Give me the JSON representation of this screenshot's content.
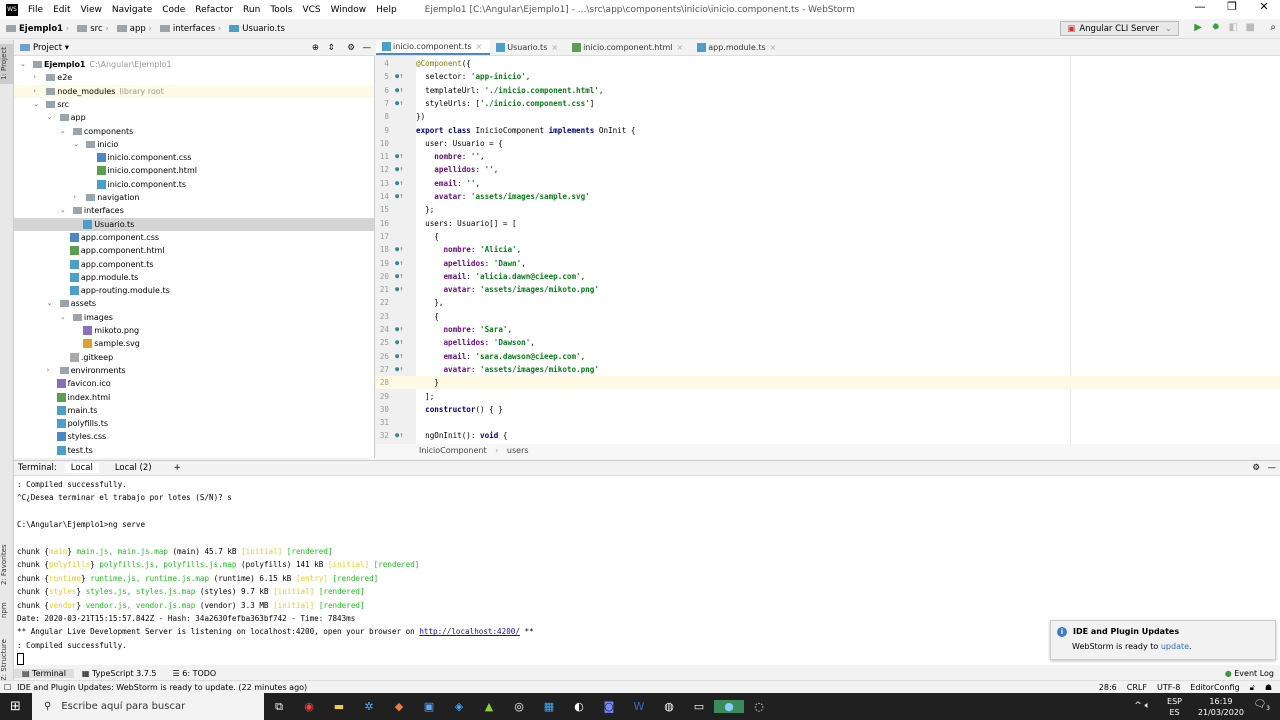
{
  "window": {
    "title": "Ejemplo1 [C:\\Angular\\Ejemplo1] - ...\\src\\app\\components\\inicio\\inicio.component.ts - WebStorm",
    "logo": "WS",
    "minimize": "—",
    "maximize": "❐",
    "close": "✕"
  },
  "menu": [
    "File",
    "Edit",
    "View",
    "Navigate",
    "Code",
    "Refactor",
    "Run",
    "Tools",
    "VCS",
    "Window",
    "Help"
  ],
  "breadcrumb": [
    "Ejemplo1",
    "src",
    "app",
    "interfaces",
    "Usuario.ts"
  ],
  "run_config": "Angular CLI Server",
  "left_strip": {
    "project": "1: Project",
    "favorites": "2: Favorites",
    "npm": "npm",
    "structure": "Z: Structure"
  },
  "project_panel": {
    "title": "Project ▾",
    "tree": [
      {
        "level": 0,
        "type": "folder",
        "open": true,
        "name": "Ejemplo1",
        "hint": "C:\\Angular\\Ejemplo1"
      },
      {
        "level": 1,
        "type": "folder",
        "open": false,
        "name": "e2e"
      },
      {
        "level": 1,
        "type": "folder",
        "open": false,
        "name": "node_modules",
        "hint": "library root",
        "lib": true
      },
      {
        "level": 1,
        "type": "folder",
        "open": true,
        "name": "src"
      },
      {
        "level": 2,
        "type": "folder",
        "open": true,
        "name": "app"
      },
      {
        "level": 3,
        "type": "folder",
        "open": true,
        "name": "components"
      },
      {
        "level": 4,
        "type": "folder",
        "open": true,
        "name": "inicio"
      },
      {
        "level": 5,
        "type": "css",
        "name": "inicio.component.css"
      },
      {
        "level": 5,
        "type": "html",
        "name": "inicio.component.html"
      },
      {
        "level": 5,
        "type": "ts",
        "name": "inicio.component.ts"
      },
      {
        "level": 4,
        "type": "folder",
        "open": false,
        "name": "navigation"
      },
      {
        "level": 3,
        "type": "folder",
        "open": true,
        "name": "interfaces"
      },
      {
        "level": 4,
        "type": "ts",
        "name": "Usuario.ts",
        "selected": true
      },
      {
        "level": 3,
        "type": "css",
        "name": "app.component.css"
      },
      {
        "level": 3,
        "type": "html",
        "name": "app.component.html"
      },
      {
        "level": 3,
        "type": "ts",
        "name": "app.component.ts"
      },
      {
        "level": 3,
        "type": "ts",
        "name": "app.module.ts"
      },
      {
        "level": 3,
        "type": "ts",
        "name": "app-routing.module.ts"
      },
      {
        "level": 2,
        "type": "folder",
        "open": true,
        "name": "assets"
      },
      {
        "level": 3,
        "type": "folder",
        "open": true,
        "name": "images"
      },
      {
        "level": 4,
        "type": "png",
        "name": "mikoto.png"
      },
      {
        "level": 4,
        "type": "svg",
        "name": "sample.svg"
      },
      {
        "level": 3,
        "type": "file",
        "name": ".gitkeep"
      },
      {
        "level": 2,
        "type": "folder",
        "open": false,
        "name": "environments"
      },
      {
        "level": 2,
        "type": "ico",
        "name": "favicon.ico"
      },
      {
        "level": 2,
        "type": "html",
        "name": "index.html"
      },
      {
        "level": 2,
        "type": "ts",
        "name": "main.ts"
      },
      {
        "level": 2,
        "type": "ts",
        "name": "polyfills.ts"
      },
      {
        "level": 2,
        "type": "css",
        "name": "styles.css"
      },
      {
        "level": 2,
        "type": "ts",
        "name": "test.ts"
      }
    ]
  },
  "editor_tabs": [
    {
      "label": "inicio.component.ts",
      "active": true
    },
    {
      "label": "Usuario.ts"
    },
    {
      "label": "inicio.component.html"
    },
    {
      "label": "app.module.ts"
    }
  ],
  "code": [
    {
      "n": "4",
      "t": [
        [
          "@Component",
          "an"
        ],
        [
          "({",
          ""
        ]
      ]
    },
    {
      "n": "5",
      "m": true,
      "t": [
        [
          "  selector: ",
          ""
        ],
        [
          "'app-inicio'",
          "st"
        ],
        [
          ",",
          ""
        ]
      ]
    },
    {
      "n": "6",
      "m": true,
      "t": [
        [
          "  templateUrl: ",
          ""
        ],
        [
          "'./inicio.component.html'",
          "st"
        ],
        [
          ",",
          ""
        ]
      ]
    },
    {
      "n": "7",
      "m": true,
      "t": [
        [
          "  styleUrls: [",
          ""
        ],
        [
          "'./inicio.component.css'",
          "st"
        ],
        [
          "]",
          ""
        ]
      ]
    },
    {
      "n": "8",
      "t": [
        [
          "})",
          ""
        ]
      ]
    },
    {
      "n": "9",
      "t": [
        [
          "export class ",
          "kw"
        ],
        [
          "InicioComponent ",
          ""
        ],
        [
          "implements ",
          "kw"
        ],
        [
          "OnInit {",
          ""
        ]
      ]
    },
    {
      "n": "10",
      "t": [
        [
          "  user: Usuario = {",
          ""
        ]
      ]
    },
    {
      "n": "11",
      "m": true,
      "t": [
        [
          "    ",
          ""
        ],
        [
          "nombre",
          "pr"
        ],
        [
          ": ",
          ""
        ],
        [
          "''",
          "st"
        ],
        [
          ",",
          ""
        ]
      ]
    },
    {
      "n": "12",
      "m": true,
      "t": [
        [
          "    ",
          ""
        ],
        [
          "apellidos",
          "pr"
        ],
        [
          ": ",
          ""
        ],
        [
          "''",
          "st"
        ],
        [
          ",",
          ""
        ]
      ]
    },
    {
      "n": "13",
      "m": true,
      "t": [
        [
          "    ",
          ""
        ],
        [
          "email",
          "pr"
        ],
        [
          ": ",
          ""
        ],
        [
          "''",
          "st"
        ],
        [
          ",",
          ""
        ]
      ]
    },
    {
      "n": "14",
      "m": true,
      "t": [
        [
          "    ",
          ""
        ],
        [
          "avatar",
          "pr"
        ],
        [
          ": ",
          ""
        ],
        [
          "'assets/images/sample.svg'",
          "st"
        ]
      ]
    },
    {
      "n": "15",
      "t": [
        [
          "  };",
          ""
        ]
      ]
    },
    {
      "n": "16",
      "t": [
        [
          "  users: Usuario[] = [",
          ""
        ]
      ]
    },
    {
      "n": "17",
      "t": [
        [
          "    {",
          ""
        ]
      ]
    },
    {
      "n": "18",
      "m": true,
      "t": [
        [
          "      ",
          ""
        ],
        [
          "nombre",
          "pr"
        ],
        [
          ": ",
          ""
        ],
        [
          "'Alicia'",
          "st"
        ],
        [
          ",",
          ""
        ]
      ]
    },
    {
      "n": "19",
      "m": true,
      "t": [
        [
          "      ",
          ""
        ],
        [
          "apellidos",
          "pr"
        ],
        [
          ": ",
          ""
        ],
        [
          "'Dawn'",
          "st"
        ],
        [
          ",",
          ""
        ]
      ]
    },
    {
      "n": "20",
      "m": true,
      "t": [
        [
          "      ",
          ""
        ],
        [
          "email",
          "pr"
        ],
        [
          ": ",
          ""
        ],
        [
          "'alicia.dawn@cieep.com'",
          "st"
        ],
        [
          ",",
          ""
        ]
      ]
    },
    {
      "n": "21",
      "m": true,
      "t": [
        [
          "      ",
          ""
        ],
        [
          "avatar",
          "pr"
        ],
        [
          ": ",
          ""
        ],
        [
          "'assets/images/mikoto.png'",
          "st"
        ]
      ]
    },
    {
      "n": "22",
      "t": [
        [
          "    },",
          ""
        ]
      ]
    },
    {
      "n": "23",
      "t": [
        [
          "    {",
          ""
        ]
      ]
    },
    {
      "n": "24",
      "m": true,
      "t": [
        [
          "      ",
          ""
        ],
        [
          "nombre",
          "pr"
        ],
        [
          ": ",
          ""
        ],
        [
          "'Sara'",
          "st"
        ],
        [
          ",",
          ""
        ]
      ]
    },
    {
      "n": "25",
      "m": true,
      "t": [
        [
          "      ",
          ""
        ],
        [
          "apellidos",
          "pr"
        ],
        [
          ": ",
          ""
        ],
        [
          "'Dawson'",
          "st"
        ],
        [
          ",",
          ""
        ]
      ]
    },
    {
      "n": "26",
      "m": true,
      "t": [
        [
          "      ",
          ""
        ],
        [
          "email",
          "pr"
        ],
        [
          ": ",
          ""
        ],
        [
          "'sara.dawson@cieep.com'",
          "st"
        ],
        [
          ",",
          ""
        ]
      ]
    },
    {
      "n": "27",
      "m": true,
      "t": [
        [
          "      ",
          ""
        ],
        [
          "avatar",
          "pr"
        ],
        [
          ": ",
          ""
        ],
        [
          "'assets/images/mikoto.png'",
          "st"
        ]
      ]
    },
    {
      "n": "28",
      "cur": true,
      "t": [
        [
          "    }",
          ""
        ]
      ]
    },
    {
      "n": "29",
      "t": [
        [
          "  ];",
          ""
        ]
      ]
    },
    {
      "n": "30",
      "t": [
        [
          "  ",
          ""
        ],
        [
          "constructor",
          "kw"
        ],
        [
          "() { }",
          ""
        ]
      ]
    },
    {
      "n": "31",
      "t": [
        [
          "",
          ""
        ]
      ]
    },
    {
      "n": "32",
      "m": true,
      "t": [
        [
          "  ngOnInit(): ",
          ""
        ],
        [
          "void ",
          "kw"
        ],
        [
          "{",
          ""
        ]
      ]
    }
  ],
  "editor_breadcrumb": [
    "InicioComponent",
    "users"
  ],
  "terminal": {
    "label": "Terminal:",
    "tabs": [
      "Local",
      "Local (2)"
    ],
    "add": "+",
    "lines": [
      [
        [
          ": Compiled successfully.",
          ""
        ]
      ],
      [
        [
          "^C¿Desea terminar el trabajo por lotes (S/N)? s",
          ""
        ]
      ],
      [
        [
          "",
          ""
        ]
      ],
      [
        [
          "C:\\Angular\\Ejemplo1>ng serve",
          ""
        ]
      ],
      [
        [
          "",
          ""
        ]
      ],
      [
        [
          "chunk {",
          ""
        ],
        [
          "main",
          "y"
        ],
        [
          "} ",
          ""
        ],
        [
          "main.js, main.js.map",
          "g"
        ],
        [
          " (main) 45.7 kB ",
          ""
        ],
        [
          "[initial]",
          "y"
        ],
        [
          " ",
          ""
        ],
        [
          "[rendered]",
          "g"
        ]
      ],
      [
        [
          "chunk {",
          ""
        ],
        [
          "polyfills",
          "y"
        ],
        [
          "} ",
          ""
        ],
        [
          "polyfills.js, polyfills.js.map",
          "g"
        ],
        [
          " (polyfills) 141 kB ",
          ""
        ],
        [
          "[initial]",
          "y"
        ],
        [
          " ",
          ""
        ],
        [
          "[rendered]",
          "g"
        ]
      ],
      [
        [
          "chunk {",
          ""
        ],
        [
          "runtime",
          "y"
        ],
        [
          "} ",
          ""
        ],
        [
          "runtime.js, runtime.js.map",
          "g"
        ],
        [
          " (runtime) 6.15 kB ",
          ""
        ],
        [
          "[entry]",
          "y"
        ],
        [
          " ",
          ""
        ],
        [
          "[rendered]",
          "g"
        ]
      ],
      [
        [
          "chunk {",
          ""
        ],
        [
          "styles",
          "y"
        ],
        [
          "} ",
          ""
        ],
        [
          "styles.js, styles.js.map",
          "g"
        ],
        [
          " (styles) 9.7 kB ",
          ""
        ],
        [
          "[initial]",
          "y"
        ],
        [
          " ",
          ""
        ],
        [
          "[rendered]",
          "g"
        ]
      ],
      [
        [
          "chunk {",
          ""
        ],
        [
          "vendor",
          "y"
        ],
        [
          "} ",
          ""
        ],
        [
          "vendor.js, vendor.js.map",
          "g"
        ],
        [
          " (vendor) 3.3 MB ",
          ""
        ],
        [
          "[initial]",
          "y"
        ],
        [
          " ",
          ""
        ],
        [
          "[rendered]",
          "g"
        ]
      ],
      [
        [
          "Date: 2020-03-21T15:15:57.842Z - Hash: 34a2630fefba363bf742 - Time: 7843ms",
          ""
        ]
      ],
      [
        [
          "** Angular Live Development Server is listening on localhost:4200, open your browser on ",
          ""
        ],
        [
          "http://localhost:4200/",
          "lnk"
        ],
        [
          " **",
          ""
        ]
      ],
      [
        [
          ": Compiled successfully.",
          ""
        ]
      ]
    ]
  },
  "notification": {
    "title": "IDE and Plugin Updates",
    "text": "WebStorm is ready to ",
    "link": "update",
    "end": "."
  },
  "tool_windows": [
    "Terminal",
    "TypeScript 3.7.5",
    "6: TODO"
  ],
  "event_log": "Event Log",
  "status": {
    "message": "IDE and Plugin Updates: WebStorm is ready to update. (22 minutes ago)",
    "position": "28:6",
    "line_sep": "CRLF",
    "encoding": "UTF-8",
    "editorconfig": "EditorConfig"
  },
  "taskbar": {
    "search_placeholder": "Escribe aquí para buscar",
    "lang1": "ESP",
    "lang2": "ES",
    "time": "16:19",
    "date": "21/03/2020",
    "notifications": "3"
  }
}
